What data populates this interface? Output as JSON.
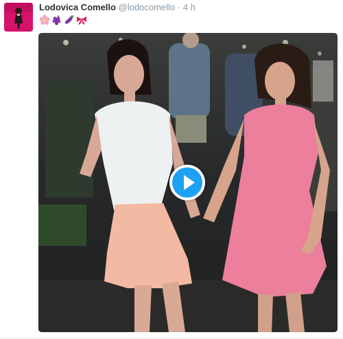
{
  "tweet": {
    "display_name": "Lodovica Comello",
    "handle": "@lodocomello",
    "separator": "·",
    "timestamp": "4 h",
    "emojis": [
      "cherry-blossom-emoji",
      "grapes-emoji",
      "eggplant-emoji",
      "ribbon-emoji"
    ],
    "media": {
      "type": "video",
      "play_icon": "play-icon"
    }
  },
  "colors": {
    "accent": "#1da1f2",
    "name_text": "#292f33",
    "secondary_text": "#8899a6",
    "avatar_bg": "#d7126a"
  }
}
